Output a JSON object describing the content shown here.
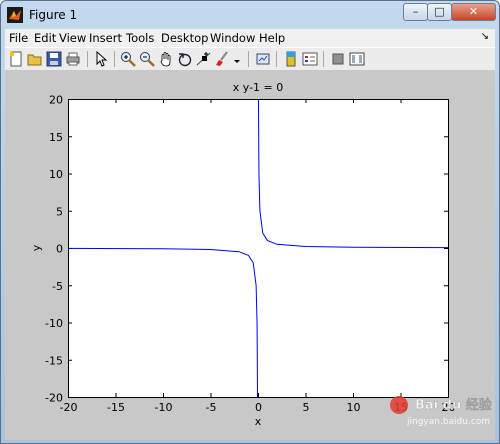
{
  "window": {
    "title": "Figure 1",
    "min_label": "–",
    "max_label": "□",
    "close_label": "✕"
  },
  "menu": {
    "items": [
      "File",
      "Edit",
      "View",
      "Insert",
      "Tools",
      "Desktop",
      "Window",
      "Help"
    ],
    "overflow_glyph": "↘"
  },
  "toolbar": {
    "icons": [
      "new-figure-icon",
      "open-file-icon",
      "save-icon",
      "print-icon",
      "edit-plot-arrow-icon",
      "zoom-in-icon",
      "zoom-out-icon",
      "pan-hand-icon",
      "rotate-3d-icon",
      "data-cursor-icon",
      "brush-icon",
      "link-plot-icon",
      "colorbar-icon",
      "legend-icon",
      "hide-plot-tools-icon",
      "show-plot-tools-icon"
    ]
  },
  "chart_data": {
    "type": "line",
    "title": "x y-1 = 0",
    "xlabel": "x",
    "ylabel": "y",
    "xlim": [
      -20,
      20
    ],
    "ylim": [
      -20,
      20
    ],
    "xticks": [
      "-20",
      "-15",
      "-10",
      "-5",
      "0",
      "5",
      "10",
      "15",
      "20"
    ],
    "yticks": [
      "20",
      "15",
      "10",
      "5",
      "0",
      "-5",
      "-10",
      "-15",
      "-20"
    ],
    "grid": false,
    "series": [
      {
        "color": "#0000ff",
        "function": "y = 1/x",
        "x": [
          -20,
          -10,
          -5,
          -2,
          -1,
          -0.5,
          -0.2,
          -0.1,
          -0.05,
          0.05,
          0.1,
          0.2,
          0.5,
          1,
          2,
          5,
          10,
          20
        ],
        "y": [
          -0.05,
          -0.1,
          -0.2,
          -0.5,
          -1,
          -2,
          -5,
          -10,
          -20,
          20,
          10,
          5,
          2,
          1,
          0.5,
          0.2,
          0.1,
          0.05
        ]
      }
    ]
  },
  "watermark": {
    "text": "Bai du 经验",
    "sub": "jingyan.baidu.com"
  }
}
